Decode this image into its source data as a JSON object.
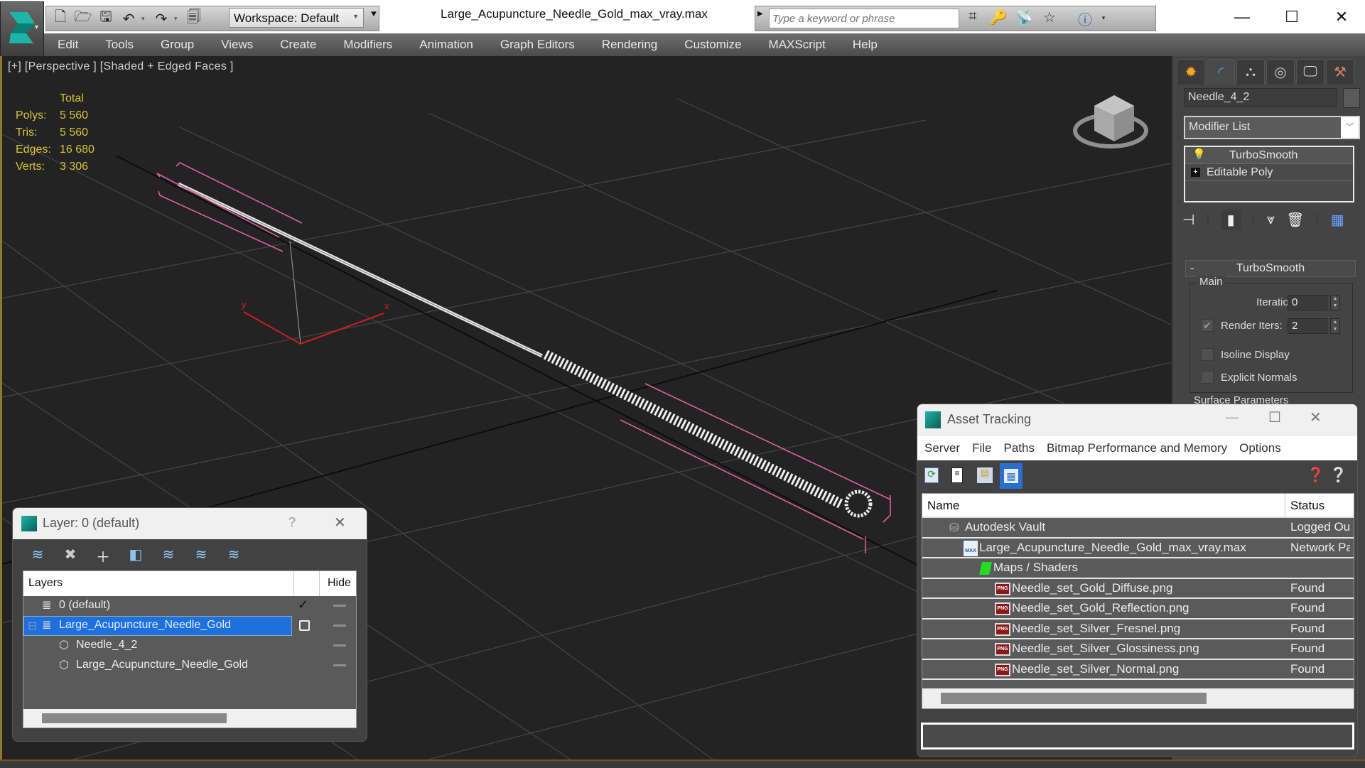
{
  "app": {
    "document_title": "Large_Acupuncture_Needle_Gold_max_vray.max",
    "workspace_label": "Workspace: Default",
    "search_placeholder": "Type a keyword or phrase"
  },
  "menu": [
    "Edit",
    "Tools",
    "Group",
    "Views",
    "Create",
    "Modifiers",
    "Animation",
    "Graph Editors",
    "Rendering",
    "Customize",
    "MAXScript",
    "Help"
  ],
  "viewport": {
    "label": "[+] [Perspective ] [Shaded + Edged Faces ]",
    "stats": {
      "header": "Total",
      "rows": [
        {
          "label": "Polys:",
          "value": "5 560"
        },
        {
          "label": "Tris:",
          "value": "5 560"
        },
        {
          "label": "Edges:",
          "value": "16 680"
        },
        {
          "label": "Verts:",
          "value": "3 306"
        }
      ]
    },
    "gizmo": {
      "x_label": "x",
      "y_label": "y"
    },
    "colors": {
      "stats": "#d6c33c",
      "selection_bracket": "#e0609a",
      "grid": "#4a4a4a",
      "gizmo": "#c8201e"
    }
  },
  "command_panel": {
    "object_name": "Needle_4_2",
    "modifier_list_label": "Modifier List",
    "stack": [
      {
        "label": "TurboSmooth",
        "icon": "lightbulb-icon"
      },
      {
        "label": "Editable Poly",
        "icon": "expand-plus-icon"
      }
    ],
    "rollout": {
      "title": "TurboSmooth",
      "collapse": "-",
      "group": "Main",
      "iterations_label": "Iterations:",
      "iterations_value": "0",
      "render_iters_label": "Render Iters:",
      "render_iters_value": "2",
      "render_iters_checked": true,
      "isoline_label": "Isoline Display",
      "isoline_checked": false,
      "explicit_normals_label": "Explicit Normals",
      "explicit_normals_checked": false,
      "next_group": "Surface Parameters"
    }
  },
  "layer_dialog": {
    "title": "Layer: 0 (default)",
    "help": "?",
    "columns": {
      "layers": "Layers",
      "hide": "Hide"
    },
    "rows": [
      {
        "name": "0 (default)",
        "type": "layer",
        "current": true,
        "selected": false
      },
      {
        "name": "Large_Acupuncture_Needle_Gold",
        "type": "layer",
        "current": false,
        "selected": true
      },
      {
        "name": "Needle_4_2",
        "type": "object",
        "selected": false
      },
      {
        "name": "Large_Acupuncture_Needle_Gold",
        "type": "object",
        "selected": false
      }
    ]
  },
  "asset_dialog": {
    "title": "Asset Tracking",
    "menu": [
      "Server",
      "File",
      "Paths",
      "Bitmap Performance and Memory",
      "Options"
    ],
    "columns": {
      "name": "Name",
      "status": "Status"
    },
    "rows": [
      {
        "name": "Autodesk Vault",
        "status": "Logged Ou",
        "icon": "vault-icon",
        "indent": 0
      },
      {
        "name": "Large_Acupuncture_Needle_Gold_max_vray.max",
        "status": "Network Pa",
        "icon": "max-file-icon",
        "indent": 1
      },
      {
        "name": "Maps / Shaders",
        "status": "",
        "icon": "maps-icon",
        "indent": 2
      },
      {
        "name": "Needle_set_Gold_Diffuse.png",
        "status": "Found",
        "icon": "png-icon",
        "indent": 3
      },
      {
        "name": "Needle_set_Gold_Reflection.png",
        "status": "Found",
        "icon": "png-icon",
        "indent": 3
      },
      {
        "name": "Needle_set_Silver_Fresnel.png",
        "status": "Found",
        "icon": "png-icon",
        "indent": 3
      },
      {
        "name": "Needle_set_Silver_Glossiness.png",
        "status": "Found",
        "icon": "png-icon",
        "indent": 3
      },
      {
        "name": "Needle_set_Silver_Normal.png",
        "status": "Found",
        "icon": "png-icon",
        "indent": 3
      }
    ],
    "png_badge": "PNG",
    "max_badge": "MAX"
  }
}
